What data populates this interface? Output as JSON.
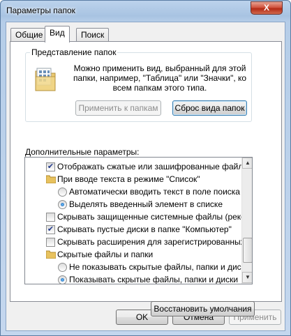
{
  "window": {
    "title": "Параметры папок",
    "close_label": "X"
  },
  "tabs": [
    {
      "label": "Общие"
    },
    {
      "label": "Вид"
    },
    {
      "label": "Поиск"
    }
  ],
  "folder_view": {
    "group_title": "Представление папок",
    "description": "Можно применить вид, выбранный для этой папки, например, \"Таблица\" или \"Значки\", ко всем папкам этого типа.",
    "apply_button": "Применить к папкам",
    "reset_button": "Сброс вида папок"
  },
  "advanced": {
    "label": "Дополнительные параметры:",
    "items": [
      {
        "type": "checkbox",
        "checked": true,
        "indent": 0,
        "text": "Отображать сжатые или зашифрованные файлы NTFS"
      },
      {
        "type": "folder",
        "indent": 0,
        "text": "При вводе текста в режиме \"Список\""
      },
      {
        "type": "radio",
        "checked": false,
        "indent": 1,
        "text": "Автоматически вводить текст в поле поиска"
      },
      {
        "type": "radio",
        "checked": true,
        "indent": 1,
        "text": "Выделять введенный элемент в списке"
      },
      {
        "type": "checkbox",
        "checked": false,
        "indent": 0,
        "text": "Скрывать защищенные системные файлы (рекомендуется)"
      },
      {
        "type": "checkbox",
        "checked": true,
        "indent": 0,
        "text": "Скрывать пустые диски в папке \"Компьютер\""
      },
      {
        "type": "checkbox",
        "checked": false,
        "indent": 0,
        "text": "Скрывать расширения для зарегистрированных типов файлов"
      },
      {
        "type": "folder",
        "indent": 0,
        "text": "Скрытые файлы и папки"
      },
      {
        "type": "radio",
        "checked": false,
        "indent": 1,
        "text": "Не показывать скрытые файлы, папки и диски"
      },
      {
        "type": "radio",
        "checked": true,
        "indent": 1,
        "text": "Показывать скрытые файлы, папки и диски"
      }
    ],
    "restore_button": "Восстановить умолчания"
  },
  "footer": {
    "ok": "OK",
    "cancel": "Отмена",
    "apply": "Применить"
  },
  "colors": {
    "titlebar": "#bcd3ec",
    "close": "#c7432c",
    "check": "#20388a"
  }
}
